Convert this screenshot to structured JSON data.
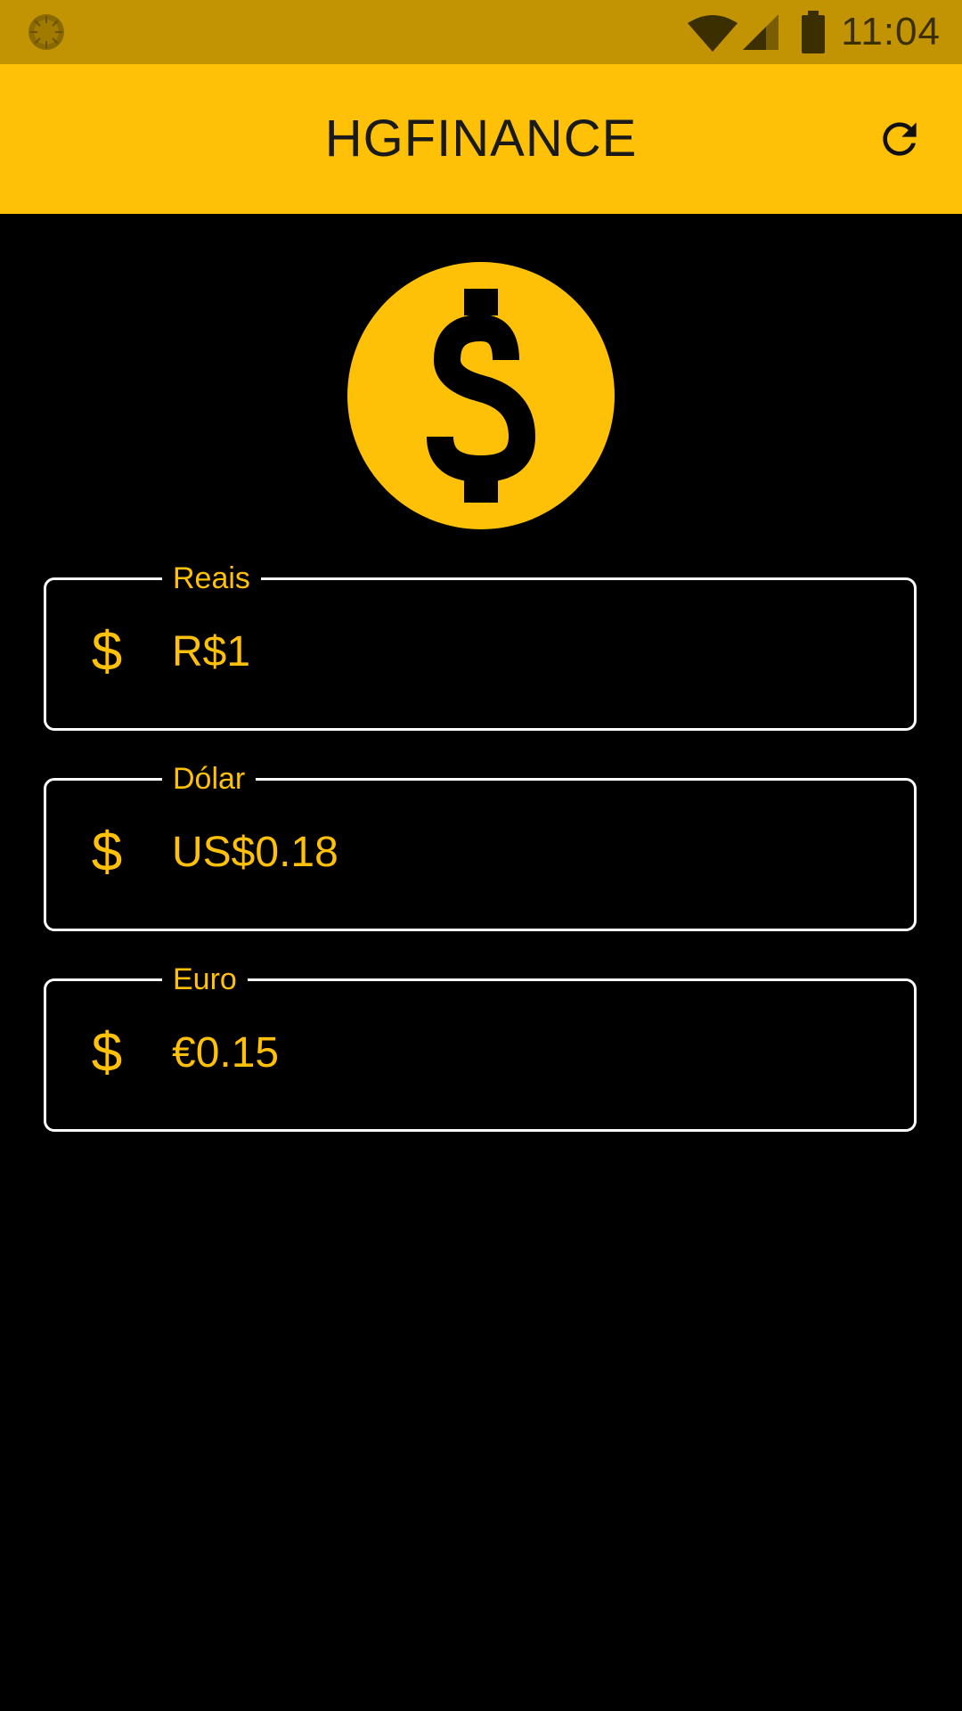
{
  "status_bar": {
    "time": "11:04",
    "icons": [
      "app-notification-icon",
      "wifi-icon",
      "cell-signal-icon",
      "battery-icon"
    ]
  },
  "app_bar": {
    "title": "HGFINANCE",
    "refresh_icon": "refresh-icon"
  },
  "hero": {
    "icon": "dollar-coin-icon"
  },
  "fields": [
    {
      "label": "Reais",
      "prefix": "$",
      "value": "R$1"
    },
    {
      "label": "Dólar",
      "prefix": "$",
      "value": "US$0.18"
    },
    {
      "label": "Euro",
      "prefix": "$",
      "value": "€0.15"
    }
  ],
  "colors": {
    "primary": "#FFC107",
    "status_bar": "#C29403",
    "background": "#000000",
    "border": "#FFFFFF"
  }
}
